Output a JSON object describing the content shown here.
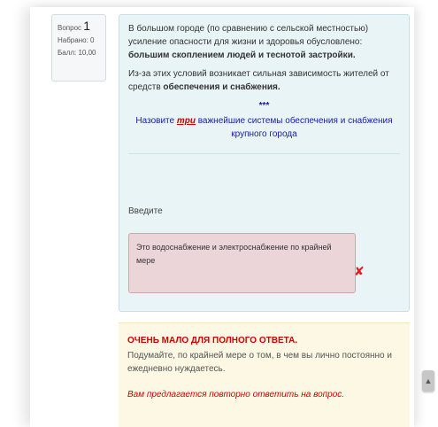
{
  "info": {
    "question_prefix": "Вопрос",
    "question_number": "1",
    "scored": "Набрано: 0",
    "points": "Балл: 10,00"
  },
  "question": {
    "p1_part1": "В большом городе (по сравнению с сельской местностью) усиление опасности для жизни и здоровья обусловлено: ",
    "p1_bold": "большим скоплением людей и теснотой застройки.",
    "p2_part1": "Из-за этих условий возникает сильная зависимость жителей от средств ",
    "p2_bold": "обеспечения и снабжения.",
    "stars": "***",
    "task_part1": "Назовите ",
    "task_emphasis": "три",
    "task_part2": " важнейшие системы обеспечения и снабжения крупного города"
  },
  "answer": {
    "label": "Введите",
    "value": "Это водоснабжение и электроснабжение по крайней мере"
  },
  "feedback": {
    "title": "ОЧЕНЬ МАЛО ДЛЯ ПОЛНОГО ОТВЕТА.",
    "text": "Подумайте, по крайней мере о том, в чем вы лично постоянно и ежедневно нуждаетесь.",
    "retry": "Вам предлагается повторно ответить на вопрос."
  },
  "icons": {
    "wrong": "cross-icon",
    "scroll": "chevron-up-icon"
  },
  "colors": {
    "question_blue": "#1a1aa6",
    "error_red": "#d10000",
    "content_bg": "#e9f4f6",
    "answer_bg": "#ecd5d8",
    "feedback_bg": "#fcf8e3"
  }
}
